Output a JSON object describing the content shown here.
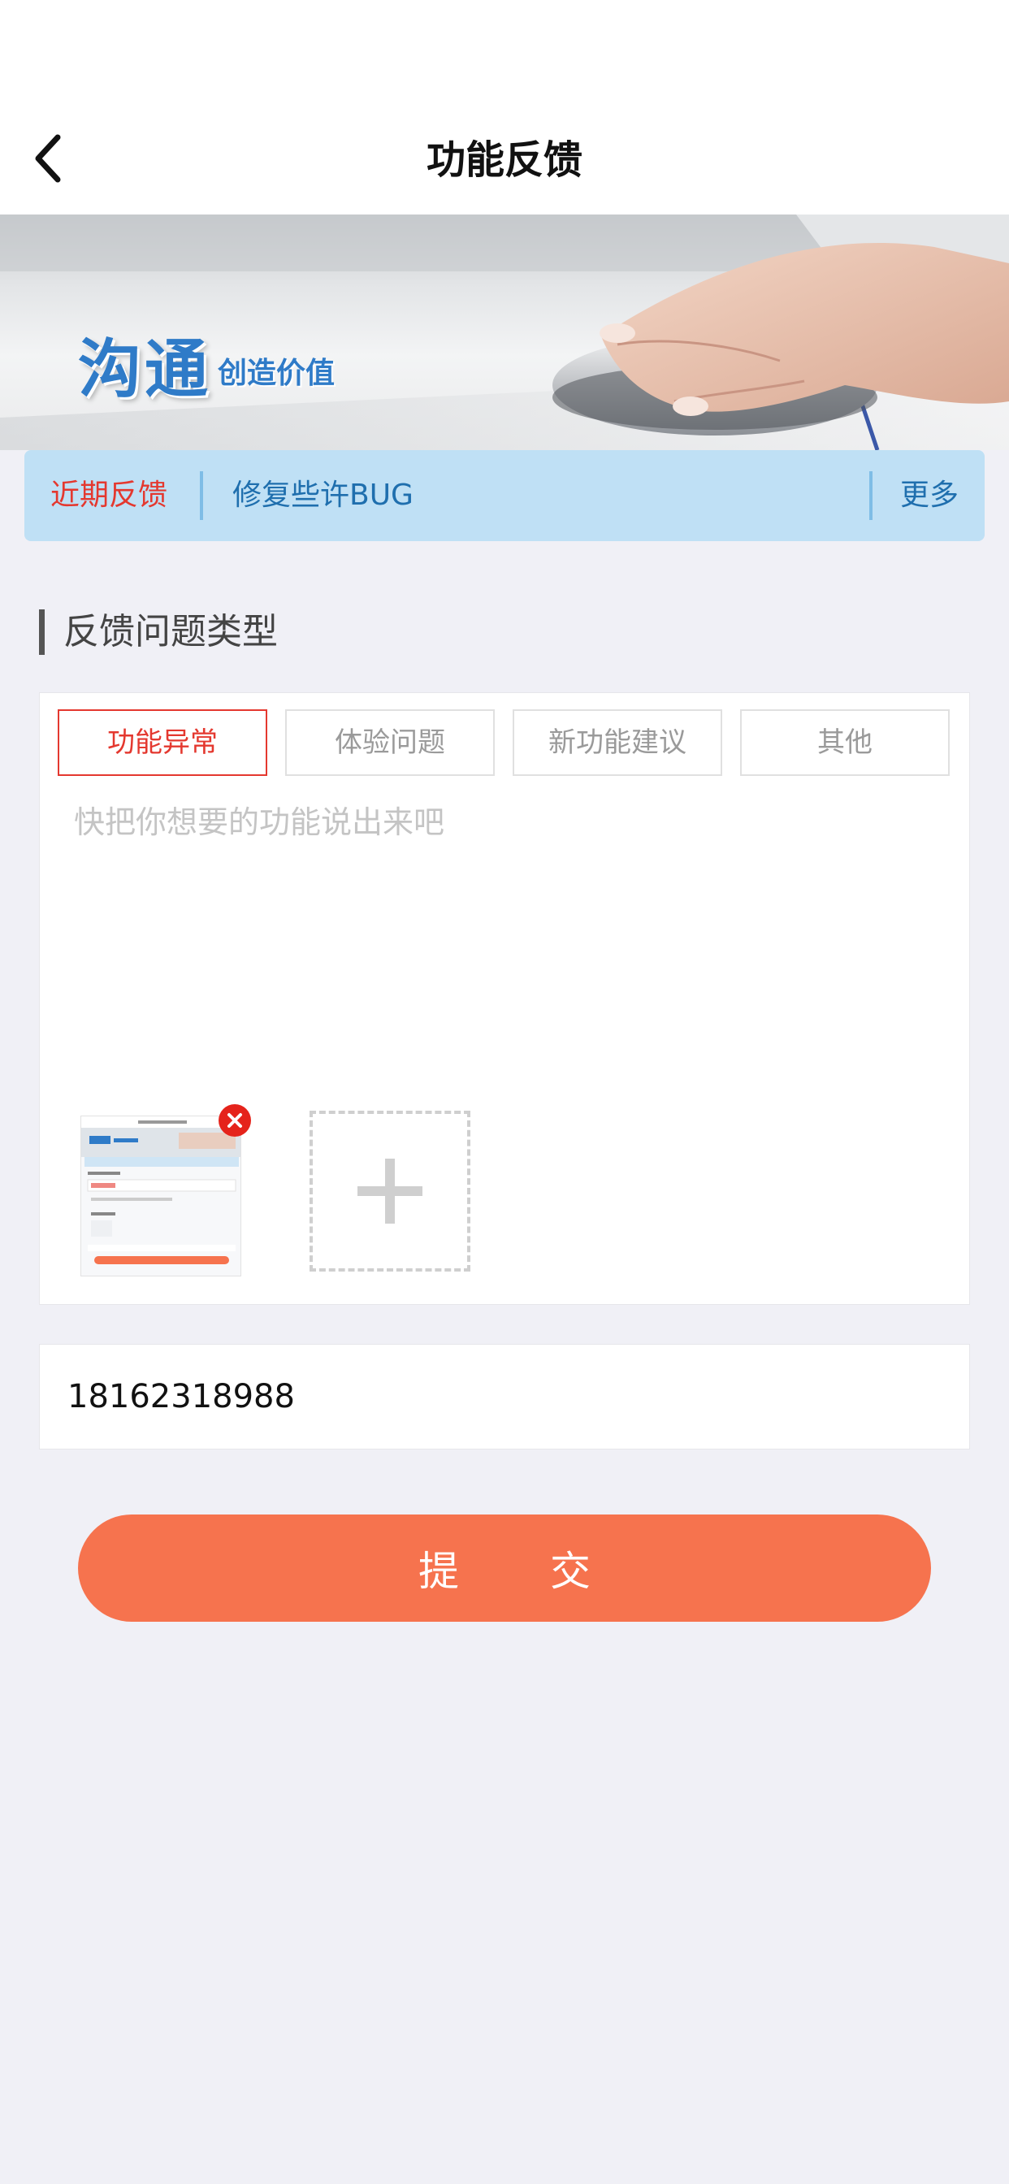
{
  "header": {
    "title": "功能反馈"
  },
  "banner": {
    "logo_text": "沟通",
    "slogan": "创造价值"
  },
  "notice": {
    "tag": "近期反馈",
    "text": "修复些许BUG",
    "more": "更多"
  },
  "section": {
    "title": "反馈问题类型"
  },
  "feedback": {
    "types": [
      {
        "label": "功能异常",
        "selected": true
      },
      {
        "label": "体验问题",
        "selected": false
      },
      {
        "label": "新功能建议",
        "selected": false
      },
      {
        "label": "其他",
        "selected": false
      }
    ],
    "placeholder": "快把你想要的功能说出来吧",
    "value": ""
  },
  "contact": {
    "phone": "18162318988"
  },
  "submit": {
    "label": "提 交"
  },
  "colors": {
    "accent": "#e4382f",
    "submit": "#f6734e",
    "notice_bg": "#bfe0f5",
    "link": "#1f6fae"
  },
  "icons": {
    "back": "chevron-left-icon",
    "remove": "close-icon",
    "add": "plus-icon"
  }
}
